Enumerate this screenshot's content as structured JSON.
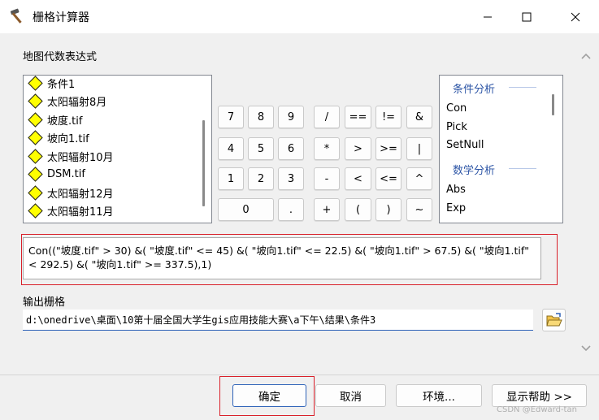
{
  "window": {
    "title": "栅格计算器"
  },
  "labels": {
    "map_algebra": "地图代数表达式",
    "output_raster": "输出栅格"
  },
  "layers": [
    "条件1",
    "太阳辐射8月",
    "坡度.tif",
    "坡向1.tif",
    "太阳辐射10月",
    "DSM.tif",
    "太阳辐射12月",
    "太阳辐射11月"
  ],
  "calculator_buttons": [
    [
      "7",
      "8",
      "9",
      "/",
      "==",
      "!=",
      "&"
    ],
    [
      "4",
      "5",
      "6",
      "*",
      ">",
      ">=",
      "|"
    ],
    [
      "1",
      "2",
      "3",
      "-",
      "<",
      "<=",
      "^"
    ],
    [
      "0",
      ".",
      "+",
      "(",
      ")",
      "~"
    ]
  ],
  "tools": {
    "cat1": "条件分析",
    "cat1_items": [
      "Con",
      "Pick",
      "SetNull"
    ],
    "cat2": "数学分析",
    "cat2_items": [
      "Abs",
      "Exp"
    ]
  },
  "expression": "Con((\"坡度.tif\" > 30) &( \"坡度.tif\" <= 45) &( \"坡向1.tif\" <= 22.5) &( \"坡向1.tif\" > 67.5) &( \"坡向1.tif\" < 292.5) &( \"坡向1.tif\" >= 337.5),1)",
  "output_path": "d:\\onedrive\\桌面\\10第十届全国大学生gis应用技能大赛\\a下午\\结果\\条件3",
  "buttons": {
    "ok": "确定",
    "cancel": "取消",
    "environments": "环境...",
    "show_help": "显示帮助 >>"
  },
  "watermark": "CSDN @Edward-tan",
  "colors": {
    "accent": "#2e62b8",
    "highlight_frame": "#d9202a",
    "category_text": "#2e56a6",
    "layer_symbol": "#ffff00"
  }
}
